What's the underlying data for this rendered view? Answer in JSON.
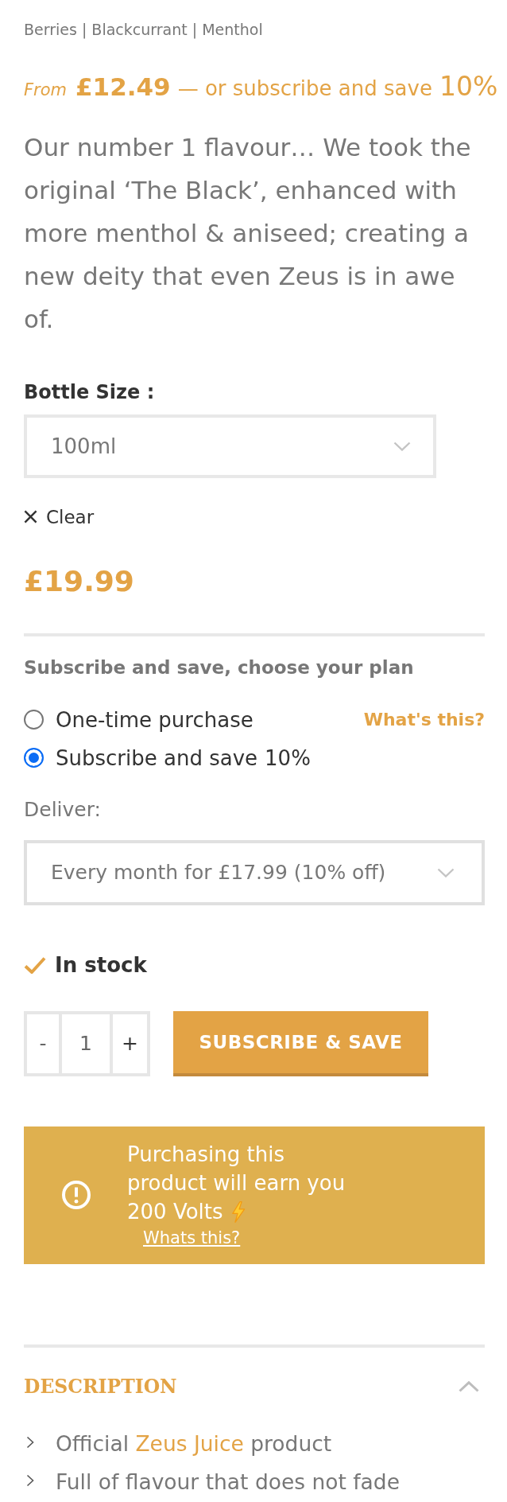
{
  "tags": "Berries | Blackcurrant | Menthol",
  "price_summary": {
    "prefix": "From",
    "price": "£12.49",
    "offer": "— or subscribe and save",
    "discount": "10%"
  },
  "description": "Our number 1 flavour… We took the original ‘The Black’, enhanced with more menthol & aniseed; creating a new deity that even Zeus is in awe of.",
  "variation": {
    "label": "Bottle Size :",
    "value": "100ml",
    "clear": "Clear"
  },
  "price": "£19.99",
  "subscription": {
    "heading": "Subscribe and save, choose your plan",
    "help_link": "What's this?",
    "options": [
      {
        "label": "One-time purchase",
        "selected": false
      },
      {
        "label": "Subscribe and save",
        "discount": "10%",
        "selected": true
      }
    ],
    "deliver_label": "Deliver:",
    "deliver_value": "Every month for £17.99 (10% off)"
  },
  "stock": "In stock",
  "cart": {
    "decrement": "-",
    "quantity": "1",
    "increment": "+",
    "button": "SUBSCRIBE & SAVE"
  },
  "points_notice": {
    "message": "Purchasing this product will earn you",
    "points": "200 Volts",
    "link": "Whats this?"
  },
  "description_tab": {
    "title": "DESCRIPTION",
    "expanded": true,
    "items": [
      {
        "text": "Official",
        "link": "Zeus Juice",
        "after": "product"
      },
      {
        "text": "Full of flavour that does not fade"
      }
    ]
  }
}
